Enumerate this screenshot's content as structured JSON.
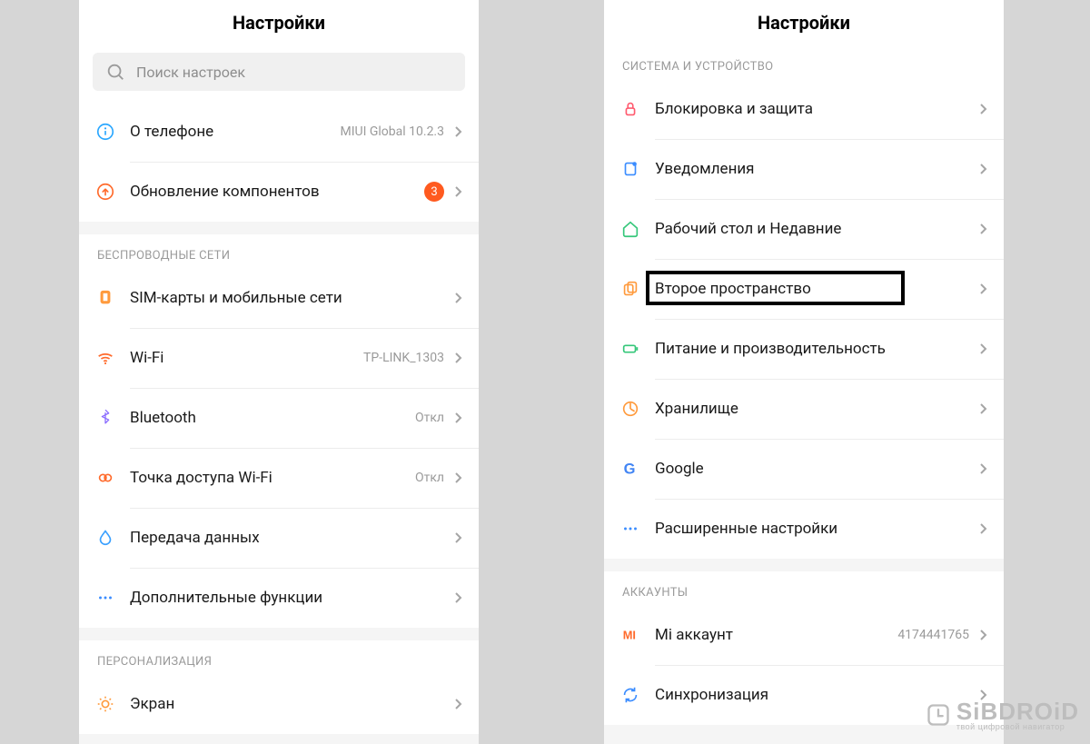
{
  "left": {
    "title": "Настройки",
    "search_placeholder": "Поиск настроек",
    "top": [
      {
        "id": "about",
        "icon": "info",
        "label": "О телефоне",
        "value": "MIUI Global 10.2.3"
      },
      {
        "id": "update",
        "icon": "update",
        "label": "Обновление компонентов",
        "badge": "3"
      }
    ],
    "groups": [
      {
        "header": "БЕСПРОВОДНЫЕ СЕТИ",
        "items": [
          {
            "id": "sim",
            "icon": "sim",
            "label": "SIM-карты и мобильные сети"
          },
          {
            "id": "wifi",
            "icon": "wifi",
            "label": "Wi-Fi",
            "value": "TP-LINK_1303"
          },
          {
            "id": "bt",
            "icon": "bt",
            "label": "Bluetooth",
            "value": "Откл"
          },
          {
            "id": "hotspot",
            "icon": "hotspot",
            "label": "Точка доступа Wi-Fi",
            "value": "Откл"
          },
          {
            "id": "data",
            "icon": "drop",
            "label": "Передача данных"
          },
          {
            "id": "morenet",
            "icon": "dots",
            "label": "Дополнительные функции"
          }
        ]
      },
      {
        "header": "ПЕРСОНАЛИЗАЦИЯ",
        "items": [
          {
            "id": "display",
            "icon": "sun",
            "label": "Экран"
          }
        ]
      }
    ]
  },
  "right": {
    "title": "Настройки",
    "groups": [
      {
        "header": "СИСТЕМА И УСТРОЙСТВО",
        "items": [
          {
            "id": "lock",
            "icon": "lock",
            "label": "Блокировка и защита"
          },
          {
            "id": "notif",
            "icon": "notif",
            "label": "Уведомления"
          },
          {
            "id": "launcher",
            "icon": "home",
            "label": "Рабочий стол и Недавние"
          },
          {
            "id": "second",
            "icon": "dual",
            "label": "Второе пространство",
            "highlight": true
          },
          {
            "id": "battery",
            "icon": "battery",
            "label": "Питание и производительность"
          },
          {
            "id": "storage",
            "icon": "storage",
            "label": "Хранилище"
          },
          {
            "id": "google",
            "icon": "google",
            "label": "Google"
          },
          {
            "id": "advanced",
            "icon": "dots",
            "label": "Расширенные настройки"
          }
        ]
      },
      {
        "header": "АККАУНТЫ",
        "items": [
          {
            "id": "mi",
            "icon": "mi",
            "label": "Mi аккаунт",
            "value": "4174441765"
          },
          {
            "id": "sync",
            "icon": "sync",
            "label": "Синхронизация"
          }
        ]
      }
    ]
  },
  "watermark": {
    "brand": "SiBDROiD",
    "tagline": "твой цифровой навигатор"
  },
  "colors": {
    "accent": "#ff5a1f"
  }
}
